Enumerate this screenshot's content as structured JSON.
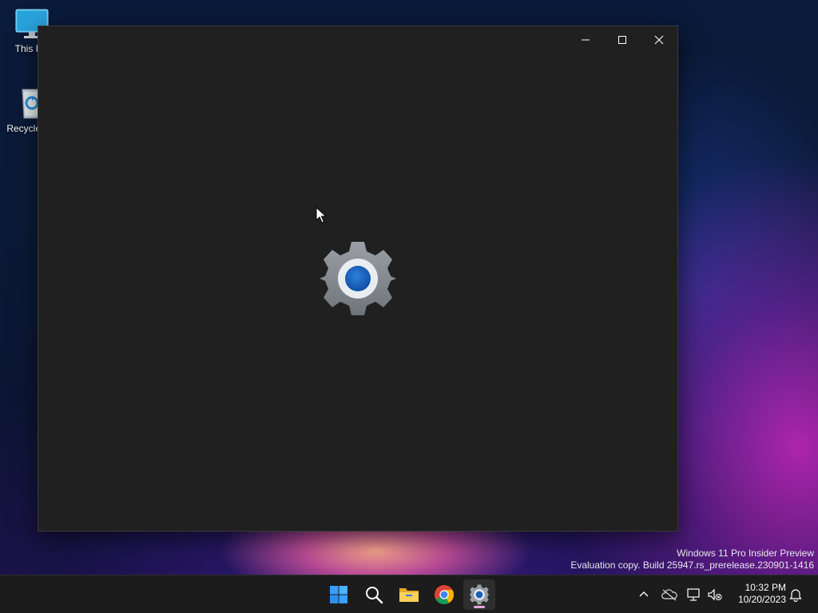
{
  "desktop": {
    "icons": [
      {
        "label": "This PC",
        "icon": "monitor-icon"
      },
      {
        "label": "Recycle Bin",
        "icon": "recycle-bin-icon"
      }
    ],
    "watermark": {
      "line1": "Windows 11 Pro Insider Preview",
      "line2": "Evaluation copy. Build 25947.rs_prerelease.230901-1416"
    }
  },
  "window": {
    "app": "Settings",
    "state": "loading-splash",
    "background": "#202020",
    "splash_icon": "settings-gear-icon",
    "caption_buttons": [
      "minimize-icon",
      "maximize-icon",
      "close-icon"
    ]
  },
  "taskbar": {
    "background": "#1c1c1c",
    "apps": [
      {
        "name": "Start",
        "icon": "windows-logo-icon"
      },
      {
        "name": "Search",
        "icon": "search-icon"
      },
      {
        "name": "File Explorer",
        "icon": "folder-icon"
      },
      {
        "name": "Google Chrome",
        "icon": "chrome-icon"
      },
      {
        "name": "Settings",
        "icon": "settings-gear-icon",
        "active": true
      }
    ],
    "tray": {
      "icons": [
        "chevron-up-icon",
        "onedrive-icon",
        "network-icon",
        "volume-muted-icon",
        "notification-bell-icon"
      ],
      "time": "10:32 PM",
      "date": "10/20/2023"
    }
  }
}
